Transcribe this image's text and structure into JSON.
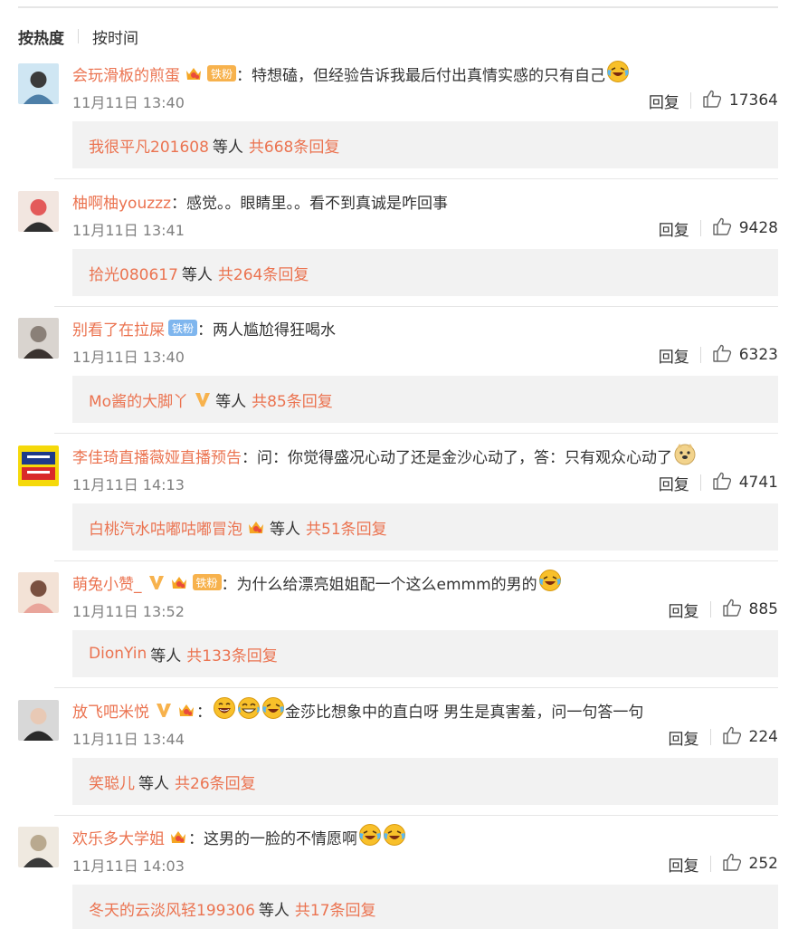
{
  "sort": {
    "hot": "按热度",
    "time": "按时间"
  },
  "reply_label": "回复",
  "others_label": "等人",
  "colors": {
    "name": "#eb7350",
    "thread_bg": "#f2f2f2",
    "fan_badge": "#f7b24d",
    "fan_badge_blue": "#7fb6ee",
    "vip": "#f7b24d"
  },
  "comments": [
    {
      "user": "会玩滑板的煎蛋",
      "badges": [
        "crown-icon",
        "fan"
      ],
      "fan_label": "铁粉",
      "text": "特想磕，但经验告诉我最后付出真情实感的只有自己",
      "emojis": [
        "laugh-cry-emoji"
      ],
      "time": "11月11日 13:40",
      "likes": "17364",
      "thread_user": "我很平凡201608",
      "thread_vip": false,
      "thread_crown": false,
      "thread_total": "共668条回复"
    },
    {
      "user": "柚啊柚youzzz",
      "badges": [],
      "fan_label": "",
      "text": "感觉。。眼睛里。。看不到真诚是咋回事",
      "emojis": [],
      "time": "11月11日 13:41",
      "likes": "9428",
      "thread_user": "拾光080617",
      "thread_vip": false,
      "thread_crown": false,
      "thread_total": "共264条回复"
    },
    {
      "user": "别看了在拉屎",
      "badges": [
        "fan-blue"
      ],
      "fan_label": "铁粉",
      "text": "两人尴尬得狂喝水",
      "emojis": [],
      "time": "11月11日 13:40",
      "likes": "6323",
      "thread_user": "Mo酱的大脚丫",
      "thread_vip": true,
      "thread_crown": false,
      "thread_total": "共85条回复"
    },
    {
      "user": "李佳琦直播薇娅直播预告",
      "badges": [],
      "fan_label": "",
      "text": "问：你觉得盛况心动了还是金沙心动了，答：只有观众心动了",
      "emojis": [
        "doge-emoji"
      ],
      "time": "11月11日 14:13",
      "likes": "4741",
      "thread_user": "白桃汽水咕嘟咕嘟冒泡",
      "thread_vip": false,
      "thread_crown": true,
      "thread_total": "共51条回复"
    },
    {
      "user": "萌兔小赞_",
      "badges": [
        "vip-icon",
        "crown-icon",
        "fan"
      ],
      "fan_label": "铁粉",
      "text": "为什么给漂亮姐姐配一个这么emmm的男的",
      "emojis": [
        "laugh-cry-emoji"
      ],
      "time": "11月11日 13:52",
      "likes": "885",
      "thread_user": "DionYin",
      "thread_vip": false,
      "thread_crown": false,
      "thread_total": "共133条回复"
    },
    {
      "user": "放飞吧米悦",
      "badges": [
        "vip-icon",
        "crown-icon"
      ],
      "fan_label": "",
      "text": "金莎比想象中的直白呀 男生是真害羞，问一句答一句",
      "emojis_before": [
        "laugh-emoji",
        "grin-emoji",
        "laugh-cry-emoji"
      ],
      "emojis": [],
      "time": "11月11日 13:44",
      "likes": "224",
      "thread_user": "笑聪儿",
      "thread_vip": false,
      "thread_crown": false,
      "thread_total": "共26条回复"
    },
    {
      "user": "欢乐多大学姐",
      "badges": [
        "crown-icon"
      ],
      "fan_label": "",
      "text": "这男的一脸的不情愿啊",
      "emojis": [
        "laugh-cry-emoji",
        "laugh-cry-emoji"
      ],
      "time": "11月11日 14:03",
      "likes": "252",
      "thread_user": "冬天的云淡风轻199306",
      "thread_vip": false,
      "thread_crown": false,
      "thread_total": "共17条回复"
    }
  ]
}
